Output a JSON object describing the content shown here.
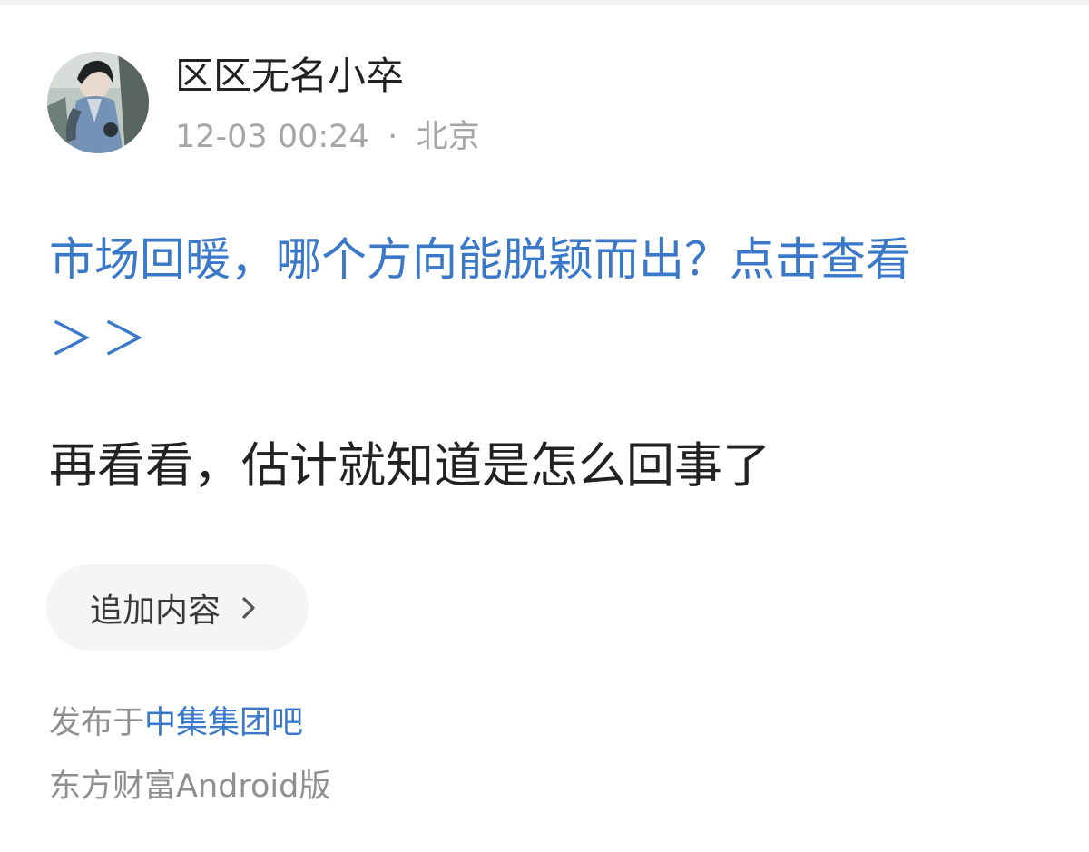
{
  "post": {
    "author": {
      "name": "区区无名小卒",
      "avatar_icon": "avatar-illustration-icon"
    },
    "time": "12-03 00:24",
    "separator": "·",
    "location": "北京",
    "promo": {
      "text": "市场回暖，哪个方向能脱颖而出？点击查看",
      "arrows": "＞＞",
      "color": "#3a78c9"
    },
    "content": "再看看，估计就知道是怎么回事了",
    "append_button": {
      "label": "追加内容",
      "icon": "chevron-right-icon"
    },
    "posted_in_prefix": "发布于",
    "forum_name": "中集集团吧",
    "source": "东方财富Android版"
  }
}
